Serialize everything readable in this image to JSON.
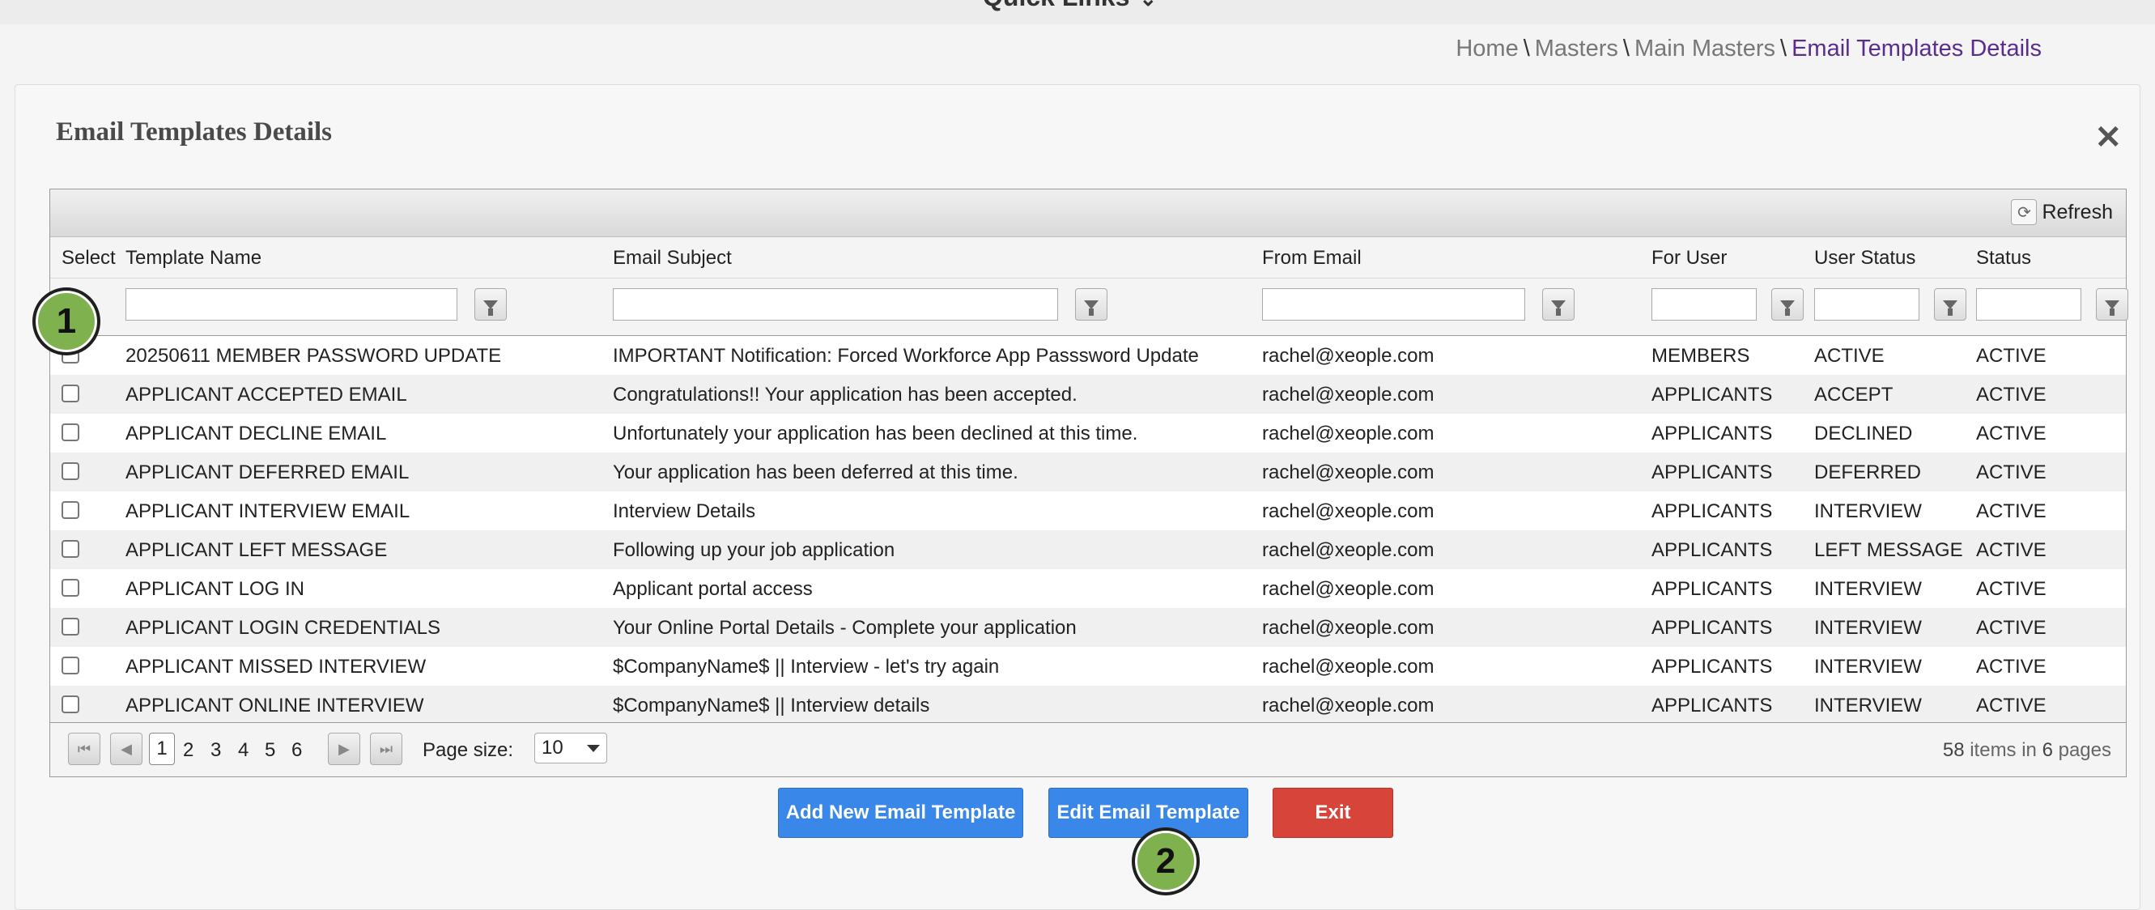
{
  "quick_links": "Quick Links",
  "breadcrumb": {
    "home": "Home",
    "masters": "Masters",
    "main_masters": "Main Masters",
    "current": "Email Templates Details"
  },
  "panel": {
    "title": "Email Templates Details"
  },
  "toolbar": {
    "refresh": "Refresh"
  },
  "columns": {
    "select": "Select",
    "template_name": "Template Name",
    "email_subject": "Email Subject",
    "from_email": "From Email",
    "for_user": "For User",
    "user_status": "User Status",
    "status": "Status"
  },
  "rows": [
    {
      "name": "20250611 MEMBER PASSWORD UPDATE",
      "subject": "IMPORTANT Notification: Forced Workforce App Passsword Update",
      "from": "rachel@xeople.com",
      "for_user": "MEMBERS",
      "user_status": "ACTIVE",
      "status": "ACTIVE"
    },
    {
      "name": "APPLICANT ACCEPTED EMAIL",
      "subject": "Congratulations!! Your application has been accepted.",
      "from": "rachel@xeople.com",
      "for_user": "APPLICANTS",
      "user_status": "ACCEPT",
      "status": "ACTIVE"
    },
    {
      "name": "APPLICANT DECLINE EMAIL",
      "subject": "Unfortunately your application has been declined at this time.",
      "from": "rachel@xeople.com",
      "for_user": "APPLICANTS",
      "user_status": "DECLINED",
      "status": "ACTIVE"
    },
    {
      "name": "APPLICANT DEFERRED EMAIL",
      "subject": "Your application has been deferred at this time.",
      "from": "rachel@xeople.com",
      "for_user": "APPLICANTS",
      "user_status": "DEFERRED",
      "status": "ACTIVE"
    },
    {
      "name": "APPLICANT INTERVIEW EMAIL",
      "subject": "Interview Details",
      "from": "rachel@xeople.com",
      "for_user": "APPLICANTS",
      "user_status": "INTERVIEW",
      "status": "ACTIVE"
    },
    {
      "name": "APPLICANT LEFT MESSAGE",
      "subject": "Following up your job application",
      "from": "rachel@xeople.com",
      "for_user": "APPLICANTS",
      "user_status": "LEFT MESSAGE",
      "status": "ACTIVE"
    },
    {
      "name": "APPLICANT LOG IN",
      "subject": "Applicant portal access",
      "from": "rachel@xeople.com",
      "for_user": "APPLICANTS",
      "user_status": "INTERVIEW",
      "status": "ACTIVE"
    },
    {
      "name": "APPLICANT LOGIN CREDENTIALS",
      "subject": "Your Online Portal Details - Complete your application",
      "from": "rachel@xeople.com",
      "for_user": "APPLICANTS",
      "user_status": "INTERVIEW",
      "status": "ACTIVE"
    },
    {
      "name": "APPLICANT MISSED INTERVIEW",
      "subject": "$CompanyName$ || Interview - let's try again",
      "from": "rachel@xeople.com",
      "for_user": "APPLICANTS",
      "user_status": "INTERVIEW",
      "status": "ACTIVE"
    },
    {
      "name": "APPLICANT ONLINE INTERVIEW",
      "subject": "$CompanyName$ || Interview details",
      "from": "rachel@xeople.com",
      "for_user": "APPLICANTS",
      "user_status": "INTERVIEW",
      "status": "ACTIVE"
    }
  ],
  "pager": {
    "pages": [
      "1",
      "2",
      "3",
      "4",
      "5",
      "6"
    ],
    "current_page": "1",
    "page_size_label": "Page size:",
    "page_size": "10",
    "total_items": "58",
    "items_in": "items in",
    "total_pages": "6",
    "pages_label": "pages"
  },
  "buttons": {
    "add": "Add New Email Template",
    "edit": "Edit Email Template",
    "exit": "Exit"
  },
  "markers": {
    "first": "1",
    "second": "2"
  },
  "icons": {
    "close": "close-icon",
    "refresh": "refresh-icon",
    "filter": "filter-icon"
  },
  "colors": {
    "breadcrumb_current": "#5a2d8c",
    "button_blue": "#3a87ea",
    "button_red": "#d7443a",
    "marker_green": "#7fb24f"
  }
}
